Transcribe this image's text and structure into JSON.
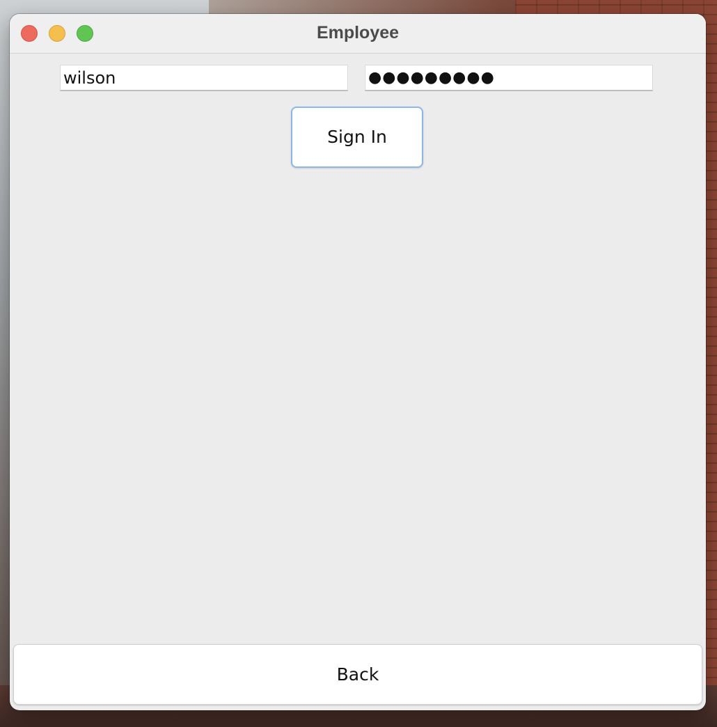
{
  "window": {
    "title": "Employee"
  },
  "login": {
    "username_value": "wilson",
    "password_masked": "●●●●●●●●●",
    "sign_in_label": "Sign In"
  },
  "footer": {
    "back_label": "Back"
  },
  "colors": {
    "close": "#ed6a5e",
    "minimize": "#f5bf4f",
    "maximize": "#61c554",
    "focus_ring": "#8db7e8",
    "window_bg": "#ececec"
  }
}
